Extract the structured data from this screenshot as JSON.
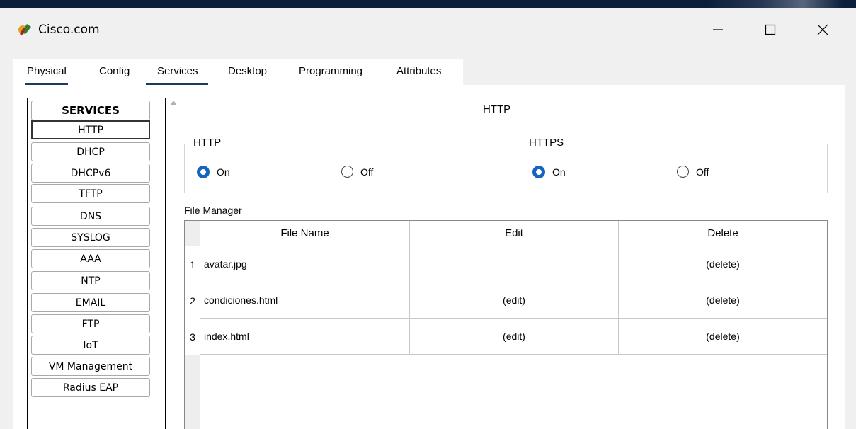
{
  "window": {
    "title": "Cisco.com",
    "controls": [
      "minimize",
      "maximize",
      "close"
    ]
  },
  "tabs": [
    {
      "label": "Physical"
    },
    {
      "label": "Config"
    },
    {
      "label": "Services",
      "active": true
    },
    {
      "label": "Desktop"
    },
    {
      "label": "Programming"
    },
    {
      "label": "Attributes"
    }
  ],
  "services": {
    "header": "SERVICES",
    "items": [
      "HTTP",
      "DHCP",
      "DHCPv6",
      "TFTP",
      "DNS",
      "SYSLOG",
      "AAA",
      "NTP",
      "EMAIL",
      "FTP",
      "IoT",
      "VM Management",
      "Radius EAP"
    ],
    "selected": "HTTP"
  },
  "http_page": {
    "title": "HTTP",
    "http_group": {
      "legend": "HTTP",
      "on_label": "On",
      "off_label": "Off",
      "value": "On"
    },
    "https_group": {
      "legend": "HTTPS",
      "on_label": "On",
      "off_label": "Off",
      "value": "On"
    },
    "file_manager": {
      "label": "File Manager",
      "columns": [
        "File Name",
        "Edit",
        "Delete"
      ],
      "rows": [
        {
          "num": "1",
          "file": "avatar.jpg",
          "edit": "",
          "delete": "(delete)"
        },
        {
          "num": "2",
          "file": "condiciones.html",
          "edit": "(edit)",
          "delete": "(delete)"
        },
        {
          "num": "3",
          "file": "index.html",
          "edit": "(edit)",
          "delete": "(delete)"
        }
      ]
    }
  },
  "colors": {
    "accent": "#1565c0",
    "tab_underline": "#1f3a5f"
  }
}
